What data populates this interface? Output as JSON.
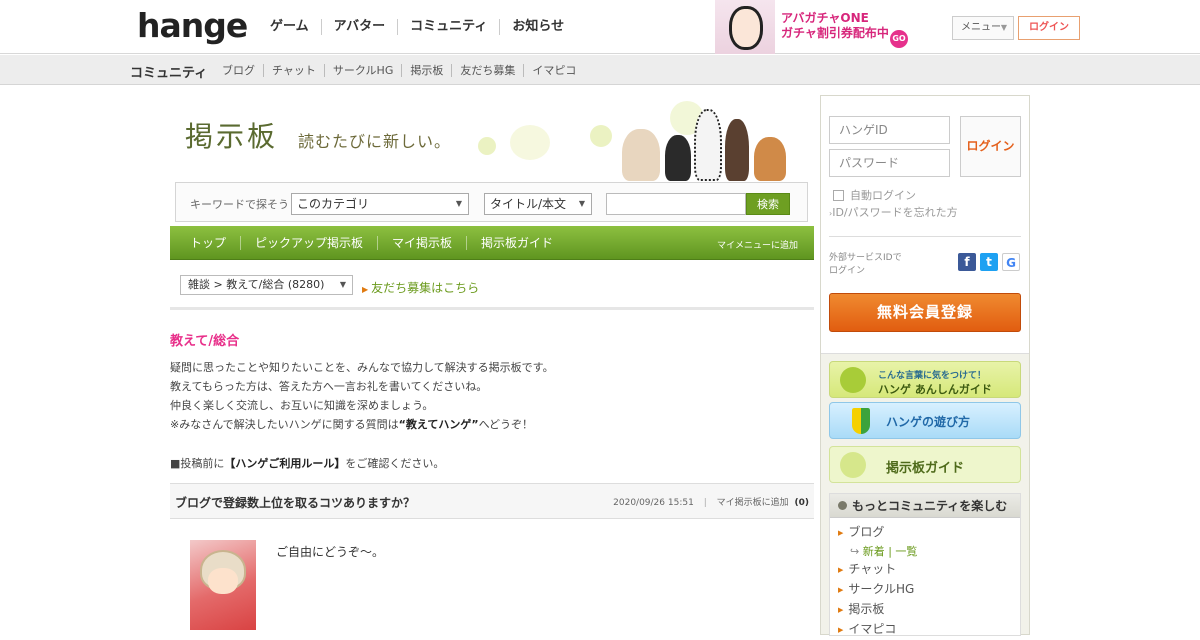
{
  "header": {
    "logo": "hange",
    "nav": [
      "ゲーム",
      "アバター",
      "コミュニティ",
      "お知らせ"
    ],
    "banner": {
      "line1": "アバガチャONE",
      "line2": "ガチャ割引券配布中",
      "go": "GO"
    },
    "menu_label": "メニュー",
    "login_label": "ログイン"
  },
  "subbar": {
    "category": "コミュニティ",
    "items": [
      "ブログ",
      "チャット",
      "サークルHG",
      "掲示板",
      "友だち募集",
      "イマピコ"
    ]
  },
  "hero": {
    "title": "掲示板",
    "tagline": "読むたびに新しい。"
  },
  "search": {
    "label": "キーワードで探そう",
    "category_value": "このカテゴリ",
    "type_value": "タイトル/本文",
    "button": "検索"
  },
  "greennav": {
    "items": [
      "トップ",
      "ピックアップ掲示板",
      "マイ掲示板",
      "掲示板ガイド"
    ],
    "add_menu": "マイメニューに追加"
  },
  "breadcrumb": {
    "value": "雑談 > 教えて/総合 (8280)",
    "friend_link": "友だち募集はこちら"
  },
  "board": {
    "title": "教えて/総合",
    "desc1": "疑問に思ったことや知りたいことを、みんなで協力して解決する掲示板です。",
    "desc2": "教えてもらった方は、答えた方へ一言お礼を書いてくださいね。",
    "desc3": "仲良く楽しく交流し、お互いに知識を深めましょう。",
    "desc4_pre": "※みなさんで解決したいハンゲに関する質問は",
    "desc4_bold": "“教えてハンゲ”",
    "desc4_post": "へどうぞ！",
    "rule_pre": "■投稿前に",
    "rule_bold": "【ハンゲご利用ルール】",
    "rule_post": "をご確認ください。"
  },
  "thread": {
    "title": "ブログで登録数上位を取るコツありますか？",
    "datetime": "2020/09/26 15:51",
    "add_label": "マイ掲示板に追加",
    "count": "(0)"
  },
  "post": {
    "body": "ご自由にどうぞ～。"
  },
  "sidebar": {
    "id_placeholder": "ハンゲID",
    "pw_placeholder": "パスワード",
    "login_button": "ログイン",
    "auto_login": "自動ログイン",
    "forgot": "ID/パスワードを忘れた方",
    "ext_line1": "外部サービスIDで",
    "ext_line2": "ログイン",
    "register": "無料会員登録",
    "banner1_small": "こんな言葉に気をつけて！",
    "banner1_large": "ハンゲ あんしんガイド",
    "banner2": "ハンゲの遊び方",
    "banner3": "掲示板ガイド",
    "more_title": "もっとコミュニティを楽しむ",
    "more_items": [
      "ブログ",
      "チャット",
      "サークルHG",
      "掲示板",
      "イマピコ"
    ],
    "blog_sub": "新着 | 一覧"
  },
  "colors": {
    "accent_green": "#6e9f22",
    "pink": "#e8308a",
    "orange": "#e15d10"
  }
}
